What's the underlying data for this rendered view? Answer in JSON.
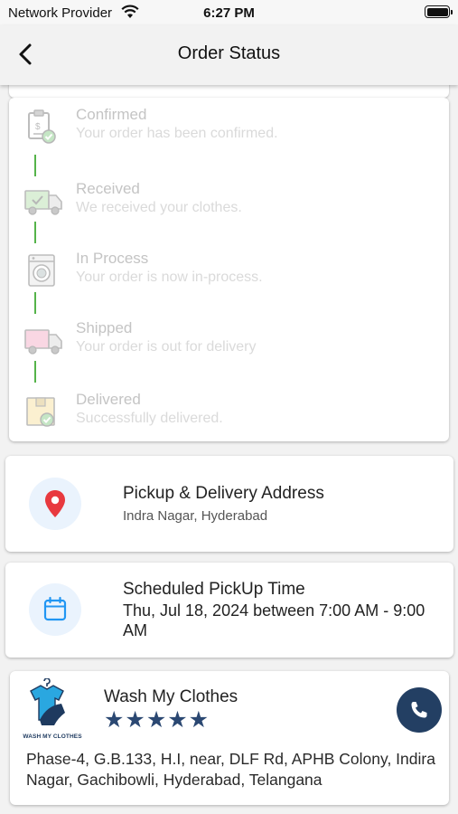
{
  "status_bar": {
    "carrier": "Network Provider",
    "time": "6:27 PM"
  },
  "header": {
    "title": "Order Status"
  },
  "tracker": {
    "steps": [
      {
        "title": "Confirmed",
        "desc": "Your order has been confirmed.",
        "icon": "clipboard-check-icon"
      },
      {
        "title": "Received",
        "desc": "We received your clothes.",
        "icon": "delivery-truck-icon"
      },
      {
        "title": "In Process",
        "desc": "Your order is now in-process.",
        "icon": "washing-machine-icon"
      },
      {
        "title": "Shipped",
        "desc": "Your order is out for delivery",
        "icon": "shipping-truck-icon"
      },
      {
        "title": "Delivered",
        "desc": "Successfully delivered.",
        "icon": "package-check-icon"
      }
    ],
    "line_color": "#55b34a"
  },
  "address": {
    "title": "Pickup & Delivery Address",
    "value": "Indra Nagar, Hyderabad",
    "icon": "location-pin-icon",
    "icon_color": "#e8393f"
  },
  "pickup": {
    "title": "Scheduled PickUp Time",
    "value": "Thu, Jul 18, 2024 between 7:00 AM - 9:00 AM",
    "icon": "calendar-icon",
    "icon_color": "#2196f3"
  },
  "store": {
    "name": "Wash My Clothes",
    "logo_text": "WASH MY CLOTHES",
    "rating": 5,
    "stars": "★★★★★",
    "address": "Phase-4, G.B.133, H.I, near, DLF Rd, APHB Colony, Indira Nagar, Gachibowli, Hyderabad, Telangana",
    "accent": "#233f63"
  }
}
